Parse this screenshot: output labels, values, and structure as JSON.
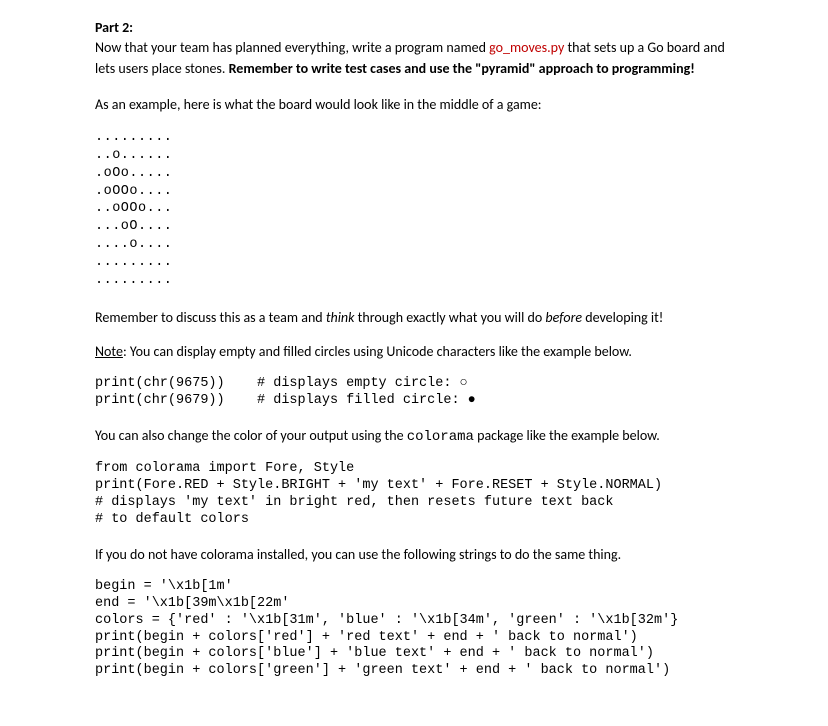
{
  "heading": "Part 2:",
  "intro": {
    "pre": "Now that your team has planned everything, write a program named ",
    "filename": "go_moves.py",
    "post": " that sets up a Go board and lets users place stones. ",
    "bold": "Remember to write test cases and use the \"pyramid\" approach to programming!"
  },
  "example_intro": "As an example, here is what the board would look like in the middle of a game:",
  "board": ".........\n..o......\n.oOo.....\n.oOOo....\n..oOOo...\n...oO....\n....o....\n.........\n.........",
  "remember": {
    "pre": "Remember to discuss this as a team and ",
    "i1": "think",
    "mid": " through exactly what you will do ",
    "i2": "before",
    "post": " developing it!"
  },
  "note": {
    "label": "Note",
    "text": ": You can display empty and filled circles using Unicode characters like the example below."
  },
  "unicode_code": "print(chr(9675))    # displays empty circle: ○\nprint(chr(9679))    # displays filled circle: ●",
  "colorama_para": {
    "pre": "You can also change the color of your output using the ",
    "code": "colorama",
    "post": " package like the example below."
  },
  "colorama_code": "from colorama import Fore, Style\nprint(Fore.RED + Style.BRIGHT + 'my text' + Fore.RESET + Style.NORMAL)\n# displays 'my text' in bright red, then resets future text back\n# to default colors",
  "fallback_para": "If you do not have colorama installed, you can use the following strings to do the same thing.",
  "fallback_code": "begin = '\\x1b[1m'\nend = '\\x1b[39m\\x1b[22m'\ncolors = {'red' : '\\x1b[31m', 'blue' : '\\x1b[34m', 'green' : '\\x1b[32m'}\nprint(begin + colors['red'] + 'red text' + end + ' back to normal')\nprint(begin + colors['blue'] + 'blue text' + end + ' back to normal')\nprint(begin + colors['green'] + 'green text' + end + ' back to normal')"
}
